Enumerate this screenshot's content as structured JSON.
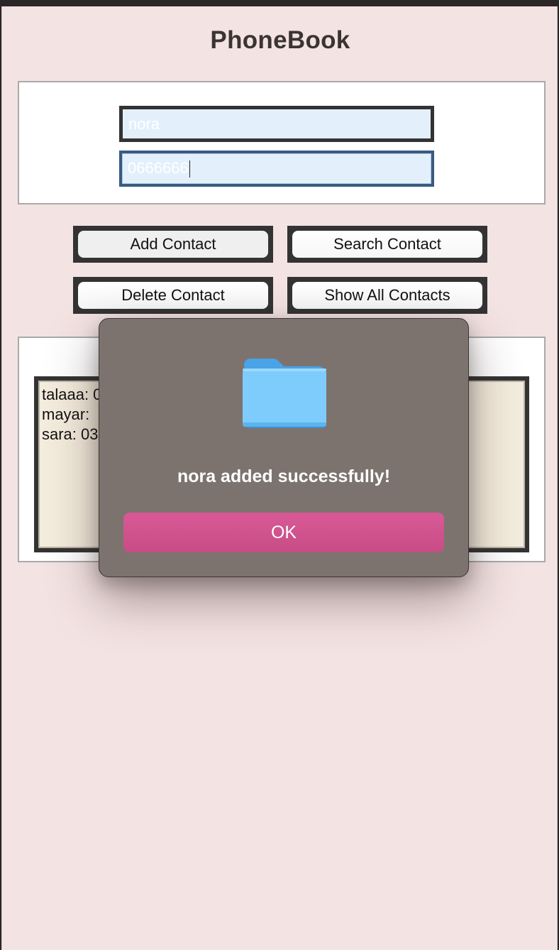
{
  "app": {
    "title": "PhoneBook"
  },
  "form": {
    "name_value": "nora",
    "phone_value": "0666666"
  },
  "buttons": {
    "add": "Add Contact",
    "search": "Search Contact",
    "delete": "Delete Contact",
    "show_all": "Show All Contacts"
  },
  "contacts": [
    {
      "text": "talaaa: 0"
    },
    {
      "text": "mayar:"
    },
    {
      "text": "sara: 03"
    }
  ],
  "dialog": {
    "icon": "folder-icon",
    "message": "nora added successfully!",
    "ok_label": "OK"
  },
  "colors": {
    "window_bg": "#f4e3e3",
    "accent_pink": "#d95996",
    "dialog_bg": "#7d736e",
    "field_bg": "#e3f0fb",
    "textarea_bg": "#f4ecdd"
  }
}
